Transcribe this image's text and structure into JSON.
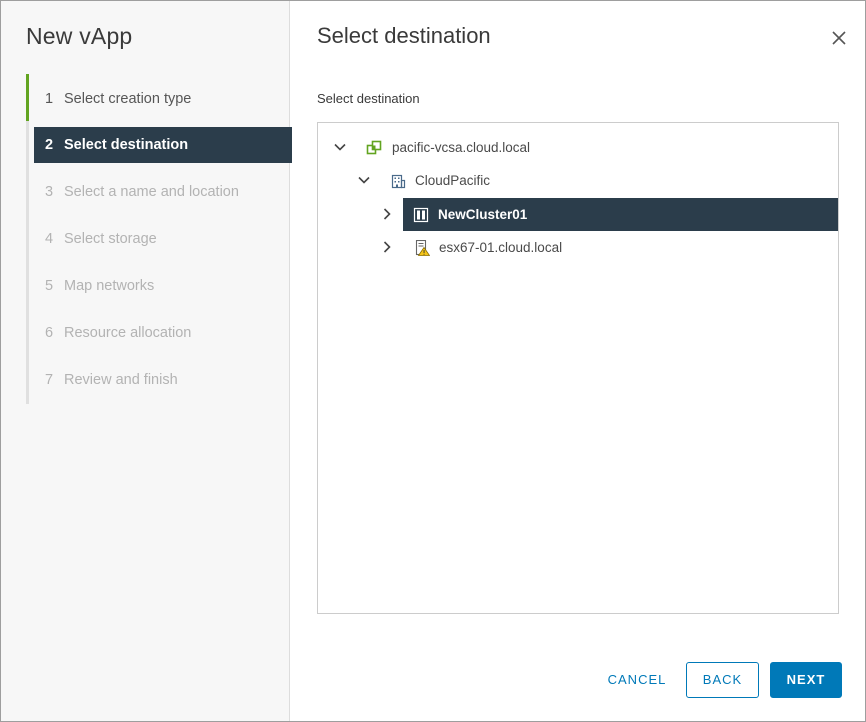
{
  "wizard": {
    "title": "New vApp",
    "steps": [
      {
        "num": "1",
        "label": "Select creation type",
        "state": "done"
      },
      {
        "num": "2",
        "label": "Select destination",
        "state": "current"
      },
      {
        "num": "3",
        "label": "Select a name and location",
        "state": "future"
      },
      {
        "num": "4",
        "label": "Select storage",
        "state": "future"
      },
      {
        "num": "5",
        "label": "Map networks",
        "state": "future"
      },
      {
        "num": "6",
        "label": "Resource allocation",
        "state": "future"
      },
      {
        "num": "7",
        "label": "Review and finish",
        "state": "future"
      }
    ]
  },
  "page": {
    "title": "Select destination",
    "section_label": "Select destination",
    "close_icon": "close-icon"
  },
  "tree": {
    "nodes": [
      {
        "label": "pacific-vcsa.cloud.local",
        "icon": "vcenter-icon",
        "expanded": true
      },
      {
        "label": "CloudPacific",
        "icon": "datacenter-icon",
        "expanded": true
      },
      {
        "label": "NewCluster01",
        "icon": "cluster-icon",
        "expanded": false,
        "selected": true
      },
      {
        "label": "esx67-01.cloud.local",
        "icon": "host-warning-icon",
        "expanded": false
      }
    ]
  },
  "footer": {
    "cancel_label": "CANCEL",
    "back_label": "BACK",
    "next_label": "NEXT"
  },
  "colors": {
    "accent": "#0079b8",
    "selected_bg": "#2b3d4b",
    "step_done": "#62a420",
    "vcenter": "#62a420",
    "warning": "#f5c518"
  }
}
